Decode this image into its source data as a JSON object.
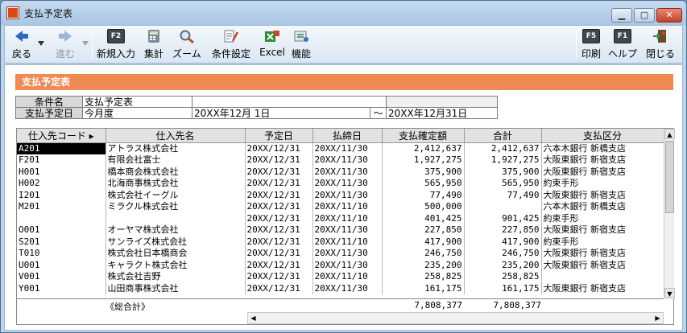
{
  "window": {
    "title": "支払予定表",
    "btn_min": "▁",
    "btn_max": "▢",
    "btn_close": "✕"
  },
  "toolbar": {
    "back": "戻る",
    "forward": "進む",
    "new_entry": {
      "key": "F2",
      "label": "新規入力"
    },
    "aggregate": "集計",
    "zoom": "ズーム",
    "conditions": "条件設定",
    "excel": "Excel",
    "functions": "機能",
    "print": {
      "key": "F5",
      "label": "印刷"
    },
    "help": {
      "key": "F1",
      "label": "ヘルプ"
    },
    "close": "閉じる"
  },
  "section_title": "支払予定表",
  "conditions": {
    "name_label": "条件名",
    "name_value": "支払予定表",
    "date_label": "支払予定日",
    "period": "今月度",
    "from": "20XX年12月 1日",
    "tilde": "～",
    "to": "20XX年12月31日"
  },
  "grid": {
    "columns": [
      "仕入先コード ▸",
      "仕入先名",
      "予定日",
      "払締日",
      "支払確定額",
      "合計",
      "支払区分"
    ],
    "rows": [
      [
        "A201",
        "アトラス株式会社",
        "20XX/12/31",
        "20XX/11/30",
        "2,412,637",
        "2,412,637",
        "六本木銀行 新橋支店"
      ],
      [
        "F201",
        "有限会社富士",
        "20XX/12/31",
        "20XX/11/30",
        "1,927,275",
        "1,927,275",
        "大阪東銀行 新宿支店"
      ],
      [
        "H001",
        "橋本商会株式会社",
        "20XX/12/31",
        "20XX/11/30",
        "375,900",
        "375,900",
        "大阪東銀行 新宿支店"
      ],
      [
        "H002",
        "北海商事株式会社",
        "20XX/12/31",
        "20XX/11/30",
        "565,950",
        "565,950",
        "約束手形"
      ],
      [
        "I201",
        "株式会社イーグル",
        "20XX/12/31",
        "20XX/11/30",
        "77,490",
        "77,490",
        "大阪東銀行 新宿支店"
      ],
      [
        "M201",
        "ミラクル株式会社",
        "20XX/12/31",
        "20XX/11/10",
        "500,000",
        "",
        "六本木銀行 新橋支店"
      ],
      [
        "",
        "",
        "20XX/12/31",
        "20XX/11/10",
        "401,425",
        "901,425",
        "約束手形"
      ],
      [
        "O001",
        "オーヤマ株式会社",
        "20XX/12/31",
        "20XX/11/30",
        "227,850",
        "227,850",
        "大阪東銀行 新宿支店"
      ],
      [
        "S201",
        "サンライズ株式会社",
        "20XX/12/31",
        "20XX/11/10",
        "417,900",
        "417,900",
        "約束手形"
      ],
      [
        "T010",
        "株式会社日本橋商会",
        "20XX/12/31",
        "20XX/11/30",
        "246,750",
        "246,750",
        "大阪東銀行 新宿支店"
      ],
      [
        "U001",
        "キャラクト株式会社",
        "20XX/12/31",
        "20XX/11/30",
        "235,200",
        "235,200",
        "大阪東銀行 新宿支店"
      ],
      [
        "V001",
        "株式会社吉野",
        "20XX/12/31",
        "20XX/11/10",
        "258,825",
        "258,825",
        ""
      ],
      [
        "Y001",
        "山田商事株式会社",
        "20XX/12/31",
        "20XX/11/30",
        "161,175",
        "161,175",
        "大阪東銀行 新宿支店"
      ]
    ],
    "total_label": "《総合計》",
    "total_confirmed": "7,808,377",
    "total_sum": "7,808,377"
  },
  "colors": {
    "accent": "#f08a54",
    "selected_cell": "#000000"
  }
}
